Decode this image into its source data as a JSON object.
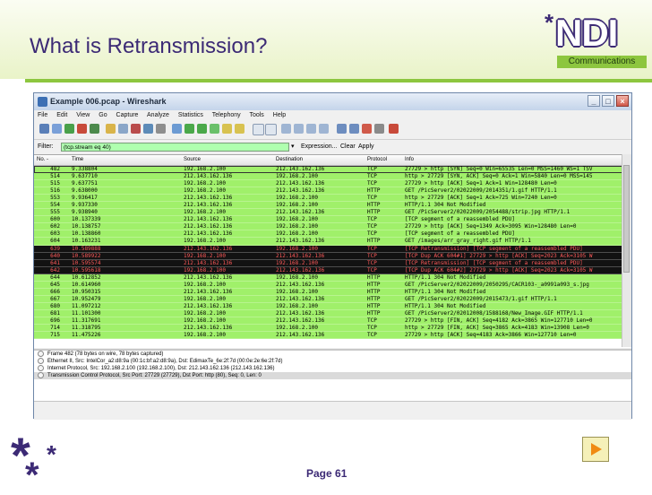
{
  "slide": {
    "title": "What is Retransmission?",
    "logo_text": "NDI",
    "logo_subtext": "Communications",
    "page_label": "Page 61"
  },
  "window": {
    "title": "Example 006.pcap - Wireshark",
    "menu": [
      "File",
      "Edit",
      "View",
      "Go",
      "Capture",
      "Analyze",
      "Statistics",
      "Telephony",
      "Tools",
      "Help"
    ],
    "filter_label": "Filter:",
    "filter_value": "(tcp.stream eq 40)",
    "expression_label": "Expression...",
    "clear_label": "Clear",
    "apply_label": "Apply"
  },
  "packet_list": {
    "columns": [
      "No. -",
      "Time",
      "Source",
      "Destination",
      "Protocol",
      "Info"
    ],
    "rows": [
      {
        "no": "482",
        "time": "9.338804",
        "src": "192.168.2.100",
        "dst": "212.143.162.136",
        "proto": "TCP",
        "info": "27729 > http [SYN] Seq=0 Win=65535 Len=0 MSS=1460 WS=1 TSV",
        "style": "green"
      },
      {
        "no": "514",
        "time": "9.637710",
        "src": "212.143.162.136",
        "dst": "192.168.2.100",
        "proto": "TCP",
        "info": "http > 27729 [SYN, ACK] Seq=0 Ack=1 Win=5840 Len=0 MSS=145",
        "style": "green"
      },
      {
        "no": "515",
        "time": "9.637751",
        "src": "192.168.2.100",
        "dst": "212.143.162.136",
        "proto": "TCP",
        "info": "27729 > http [ACK] Seq=1 Ack=1 Win=128480 Len=0",
        "style": "green"
      },
      {
        "no": "516",
        "time": "9.638000",
        "src": "192.168.2.100",
        "dst": "212.143.162.136",
        "proto": "HTTP",
        "info": "GET /PicServer2/02022009/2014351/1.gif HTTP/1.1",
        "style": "green"
      },
      {
        "no": "553",
        "time": "9.936417",
        "src": "212.143.162.136",
        "dst": "192.168.2.100",
        "proto": "TCP",
        "info": "http > 27729 [ACK] Seq=1 Ack=725 Win=7240 Len=0",
        "style": "green"
      },
      {
        "no": "554",
        "time": "9.937330",
        "src": "212.143.162.136",
        "dst": "192.168.2.100",
        "proto": "HTTP",
        "info": "HTTP/1.1 304 Not Modified",
        "style": "green"
      },
      {
        "no": "555",
        "time": "9.938940",
        "src": "192.168.2.100",
        "dst": "212.143.162.136",
        "proto": "HTTP",
        "info": "GET /PicServer2/02022009/2054488/strip.jpg HTTP/1.1",
        "style": "green"
      },
      {
        "no": "600",
        "time": "10.137339",
        "src": "212.143.162.136",
        "dst": "192.168.2.100",
        "proto": "TCP",
        "info": "[TCP segment of a reassembled PDU]",
        "style": "green"
      },
      {
        "no": "602",
        "time": "10.138757",
        "src": "212.143.162.136",
        "dst": "192.168.2.100",
        "proto": "TCP",
        "info": "27729 > http [ACK] Seq=1349 Ack=3095 Win=128480 Len=0",
        "style": "green"
      },
      {
        "no": "603",
        "time": "10.138860",
        "src": "212.143.162.136",
        "dst": "192.168.2.100",
        "proto": "TCP",
        "info": "[TCP segment of a reassembled PDU]",
        "style": "green"
      },
      {
        "no": "604",
        "time": "10.163231",
        "src": "192.168.2.100",
        "dst": "212.143.162.136",
        "proto": "HTTP",
        "info": "GET /images/arr_gray_right.gif HTTP/1.1",
        "style": "green"
      },
      {
        "no": "639",
        "time": "10.589888",
        "src": "212.143.162.136",
        "dst": "192.168.2.100",
        "proto": "TCP",
        "info": "[TCP Retransmission] [TCP segment of a reassembled PDU]",
        "style": "black"
      },
      {
        "no": "640",
        "time": "10.589922",
        "src": "192.168.2.100",
        "dst": "212.143.162.136",
        "proto": "TCP",
        "info": "[TCP Dup ACK 604#1] 27729 > http [ACK] Seq=2023 Ack=3105 W",
        "style": "black"
      },
      {
        "no": "641",
        "time": "10.595574",
        "src": "212.143.162.136",
        "dst": "192.168.2.100",
        "proto": "TCP",
        "info": "[TCP Retransmission] [TCP segment of a reassembled PDU]",
        "style": "black"
      },
      {
        "no": "642",
        "time": "10.595618",
        "src": "192.168.2.100",
        "dst": "212.143.162.136",
        "proto": "TCP",
        "info": "[TCP Dup ACK 604#2] 27729 > http [ACK] Seq=2023 Ack=3105 W",
        "style": "black"
      },
      {
        "no": "644",
        "time": "10.612852",
        "src": "212.143.162.136",
        "dst": "192.168.2.100",
        "proto": "HTTP",
        "info": "HTTP/1.1 304 Not Modified",
        "style": "green"
      },
      {
        "no": "645",
        "time": "10.614960",
        "src": "192.168.2.100",
        "dst": "212.143.162.136",
        "proto": "HTTP",
        "info": "GET /PicServer2/02022009/2050295/CACR103-_a0991a093_s.jpg",
        "style": "green"
      },
      {
        "no": "666",
        "time": "10.950315",
        "src": "212.143.162.136",
        "dst": "192.168.2.100",
        "proto": "HTTP",
        "info": "HTTP/1.1 304 Not Modified",
        "style": "green"
      },
      {
        "no": "667",
        "time": "10.952479",
        "src": "192.168.2.100",
        "dst": "212.143.162.136",
        "proto": "HTTP",
        "info": "GET /PicServer2/02022009/2015473/1.gif HTTP/1.1",
        "style": "green"
      },
      {
        "no": "680",
        "time": "11.097212",
        "src": "212.143.162.136",
        "dst": "192.168.2.100",
        "proto": "HTTP",
        "info": "HTTP/1.1 304 Not Modified",
        "style": "green"
      },
      {
        "no": "681",
        "time": "11.101300",
        "src": "192.168.2.100",
        "dst": "212.143.162.136",
        "proto": "HTTP",
        "info": "GET /PicServer2/02012008/1588168/New_Image.GIF HTTP/1.1",
        "style": "green"
      },
      {
        "no": "696",
        "time": "11.317691",
        "src": "192.168.2.100",
        "dst": "212.143.162.136",
        "proto": "TCP",
        "info": "27729 > http [FIN, ACK] Seq=4182 Ack=3865 Win=127710 Len=0",
        "style": "green"
      },
      {
        "no": "714",
        "time": "11.318795",
        "src": "212.143.162.136",
        "dst": "192.168.2.100",
        "proto": "TCP",
        "info": "http > 27729 [FIN, ACK] Seq=3865 Ack=4183 Win=13908 Len=0",
        "style": "green"
      },
      {
        "no": "715",
        "time": "11.475226",
        "src": "192.168.2.100",
        "dst": "212.143.162.136",
        "proto": "TCP",
        "info": "27729 > http [ACK] Seq=4183 Ack=3866 Win=127710 Len=0",
        "style": "green"
      }
    ]
  },
  "details": [
    "Frame 482 (78 bytes on wire, 78 bytes captured)",
    "Ethernet II, Src: IntelCor_a2:d8:9a (00:1c:bf:a2:d8:9a), Dst: EdimaxTe_6e:2f:7d (00:0e:2e:6e:2f:7d)",
    "Internet Protocol, Src: 192.168.2.100 (192.168.2.100), Dst: 212.143.162.136 (212.143.162.136)",
    "Transmission Control Protocol, Src Port: 27729 (27729), Dst Port: http (80), Seq: 0, Len: 0"
  ],
  "colors": {
    "brand_purple": "#3c2a75",
    "brand_green": "#8dc63f",
    "row_green": "#a0f06a",
    "row_black": "#121212",
    "row_black_text": "#ff5a5a"
  }
}
